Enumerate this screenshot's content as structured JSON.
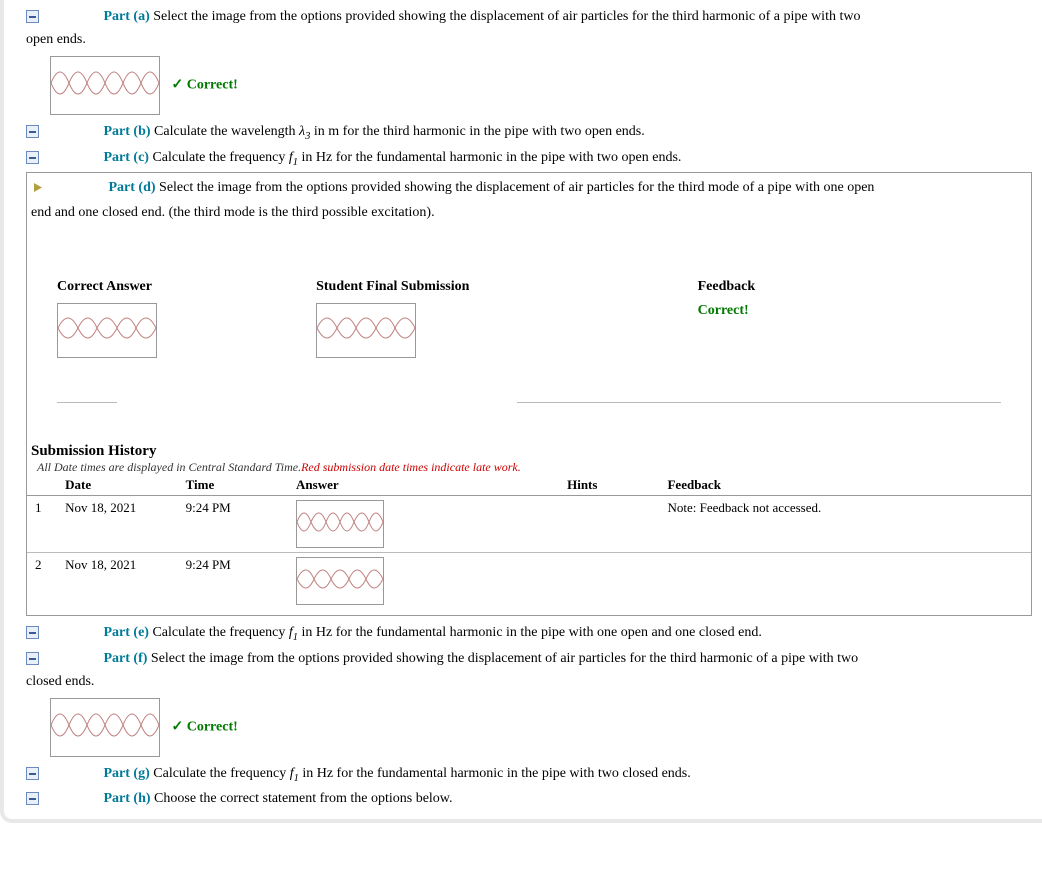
{
  "parts": {
    "a": {
      "label": "Part (a)",
      "text": "Select the image from the options provided showing the displacement of air particles for the third harmonic of a pipe with two open ends.",
      "status": "Correct!"
    },
    "b": {
      "label": "Part (b)",
      "text": "Calculate the wavelength λ₃ in m for the third harmonic in the pipe with two open ends."
    },
    "c": {
      "label": "Part (c)",
      "text": "Calculate the frequency f₁ in Hz for the fundamental harmonic in the pipe with two open ends."
    },
    "d": {
      "label": "Part (d)",
      "text": "Select the image from the options provided showing the displacement of air particles for the third mode of a pipe with one open end and one closed end. (the third mode is the third possible excitation)."
    },
    "e": {
      "label": "Part (e)",
      "text": "Calculate the frequency f₁ in Hz for the fundamental harmonic in the pipe with one open and one closed end."
    },
    "f": {
      "label": "Part (f)",
      "text": "Select the image from the options provided showing the displacement of air particles for the third harmonic of a pipe with two closed ends.",
      "status": "Correct!"
    },
    "g": {
      "label": "Part (g)",
      "text": "Calculate the frequency f₁ in Hz for the fundamental harmonic in the pipe with two closed ends."
    },
    "h": {
      "label": "Part (h)",
      "text": "Choose the correct statement from the options below."
    }
  },
  "feedback_row": {
    "h_correct": "Correct Answer",
    "h_student": "Student Final Submission",
    "h_feedback": "Feedback",
    "feedback_text": "Correct!"
  },
  "history": {
    "title": "Submission History",
    "note_prefix": "All Date times are displayed in Central Standard Time.",
    "note_red": "Red submission date times indicate late work.",
    "headers": {
      "num": "",
      "date": "Date",
      "time": "Time",
      "answer": "Answer",
      "hints": "Hints",
      "feedback": "Feedback"
    },
    "rows": [
      {
        "num": "1",
        "date": "Nov 18, 2021",
        "time": "9:24 PM",
        "hints": "",
        "feedback": "Note: Feedback not accessed."
      },
      {
        "num": "2",
        "date": "Nov 18, 2021",
        "time": "9:24 PM",
        "hints": "",
        "feedback": ""
      }
    ]
  },
  "continuation_a": "open ends.",
  "continuation_f": "closed ends."
}
